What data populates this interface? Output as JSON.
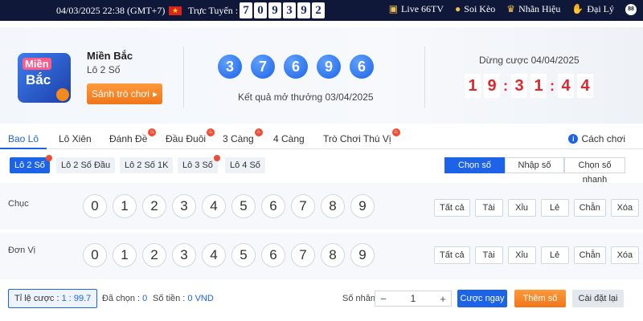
{
  "topbar": {
    "datetime": "04/03/2025 22:38 (GMT+7)",
    "online_label": "Trực Tuyến :",
    "online_digits": [
      "7",
      "0",
      "9",
      "3",
      "9",
      "2"
    ],
    "nav": [
      {
        "label": "Live 66TV",
        "icon": "tv-icon"
      },
      {
        "label": "Soi Kèo",
        "icon": "ball-icon"
      },
      {
        "label": "Nhãn Hiệu",
        "icon": "trophy-icon"
      },
      {
        "label": "Đại Lý",
        "icon": "handshake-icon"
      }
    ]
  },
  "header": {
    "logo_line1": "Miền",
    "logo_line2": "Bắc",
    "region_title": "Miền Bắc",
    "region_sub": "Lô 2 Số",
    "lobby_button": "Sảnh trò chơi",
    "result_balls": [
      "3",
      "7",
      "6",
      "9",
      "6"
    ],
    "result_label": "Kết quả mở thưởng 03/04/2025",
    "stop_label": "Dừng cược 04/04/2025",
    "countdown": [
      "1",
      "9",
      ":",
      "3",
      "1",
      ":",
      "4",
      "4"
    ]
  },
  "tabs": [
    {
      "label": "Bao Lô",
      "active": true,
      "hot": false
    },
    {
      "label": "Lô Xiên",
      "active": false,
      "hot": false
    },
    {
      "label": "Đánh Đề",
      "active": false,
      "hot": true
    },
    {
      "label": "Đầu Đuôi",
      "active": false,
      "hot": true
    },
    {
      "label": "3 Càng",
      "active": false,
      "hot": true
    },
    {
      "label": "4 Càng",
      "active": false,
      "hot": false
    },
    {
      "label": "Trò Chơi Thú Vị",
      "active": false,
      "hot": true
    }
  ],
  "howto_label": "Cách chơi",
  "subtabs": [
    {
      "label": "Lô 2 Số",
      "active": true,
      "hot": true
    },
    {
      "label": "Lô 2 Số Đầu",
      "active": false,
      "hot": false
    },
    {
      "label": "Lô 2 Số 1K",
      "active": false,
      "hot": false
    },
    {
      "label": "Lô 3 Số",
      "active": false,
      "hot": true
    },
    {
      "label": "Lô 4 Số",
      "active": false,
      "hot": false
    }
  ],
  "modes": [
    "Chọn số",
    "Nhập số",
    "Chọn số nhanh"
  ],
  "rows": [
    {
      "label": "Chục",
      "numbers": [
        "0",
        "1",
        "2",
        "3",
        "4",
        "5",
        "6",
        "7",
        "8",
        "9"
      ]
    },
    {
      "label": "Đơn Vị",
      "numbers": [
        "0",
        "1",
        "2",
        "3",
        "4",
        "5",
        "6",
        "7",
        "8",
        "9"
      ]
    }
  ],
  "quick_picks": [
    "Tất cả",
    "Tài",
    "Xỉu",
    "Lẻ",
    "Chẵn",
    "Xóa"
  ],
  "footer": {
    "odds_label": "Tỉ lệ cược :",
    "odds_value": "1 : 99.7",
    "selected_label": "Đã chọn :",
    "selected_value": "0",
    "amount_label": "Số tiền :",
    "amount_value": "0 VND",
    "multiplier_label": "Số nhân :",
    "multiplier_value": "1",
    "bet_button": "Cược ngay",
    "add_button": "Thêm số",
    "reset_button": "Cài đặt lại"
  }
}
